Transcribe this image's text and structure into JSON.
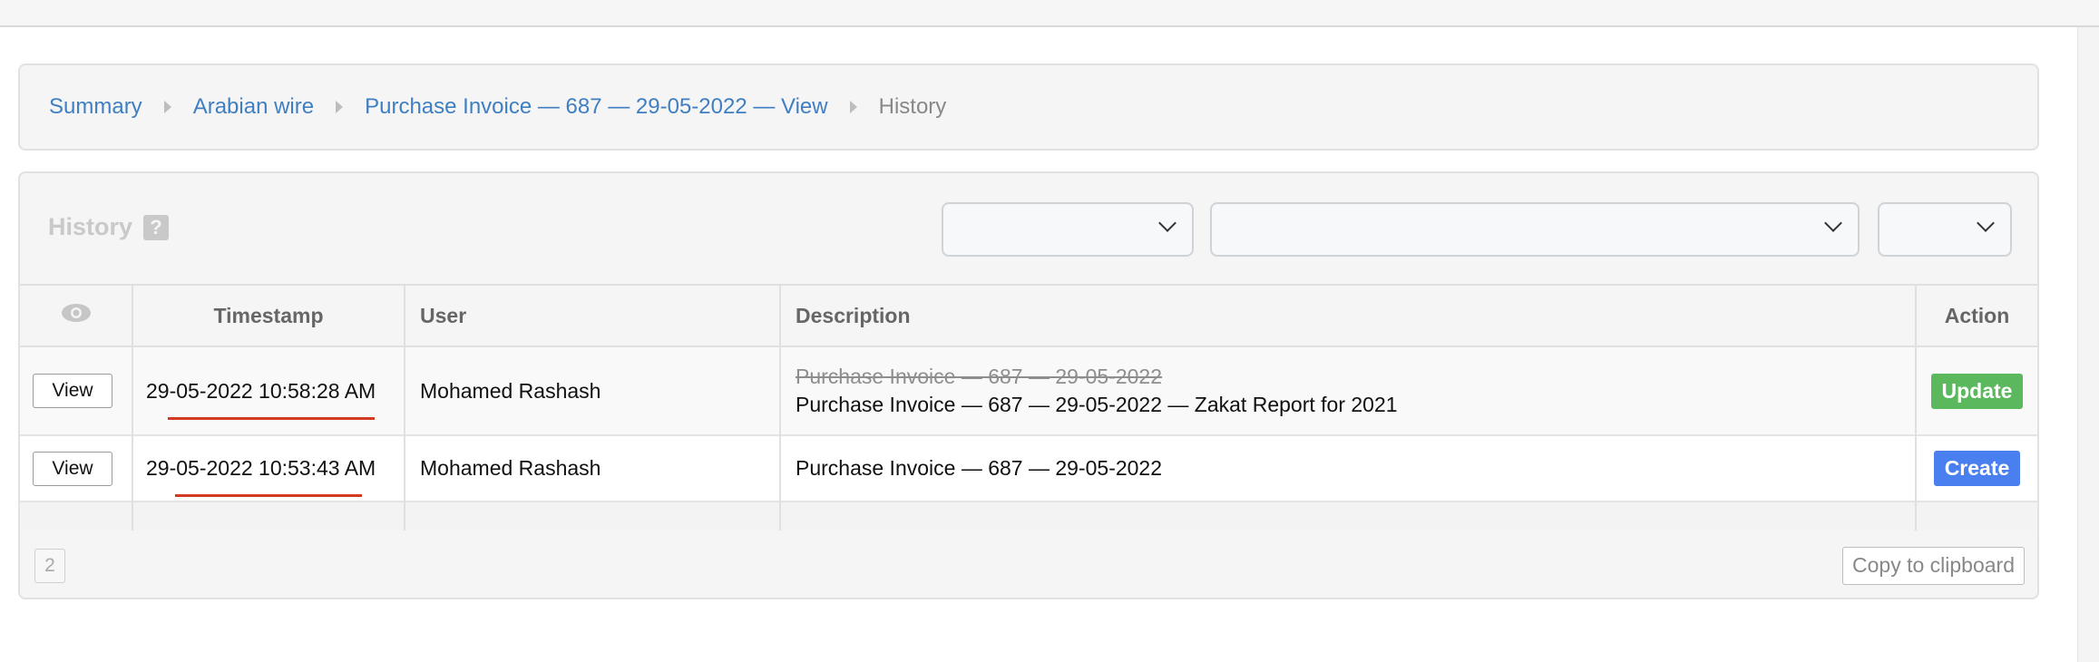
{
  "breadcrumb": {
    "items": [
      {
        "label": "Summary"
      },
      {
        "label": "Arabian wire"
      },
      {
        "label": "Purchase Invoice — 687 — 29-05-2022 — View"
      },
      {
        "label": "History"
      }
    ]
  },
  "history": {
    "title": "History",
    "help_icon": "?",
    "filters": [
      {
        "selected": ""
      },
      {
        "selected": ""
      },
      {
        "selected": ""
      }
    ],
    "columns": [
      "",
      "Timestamp",
      "User",
      "Description",
      "Action"
    ],
    "rows": [
      {
        "view_label": "View",
        "timestamp": "29-05-2022 10:58:28 AM",
        "user": "Mohamed Rashash",
        "old_description": "Purchase Invoice — 687 — 29-05-2022",
        "description": "Purchase Invoice — 687 — 29-05-2022 — Zakat Report for 2021",
        "action": "Update",
        "action_color": "#5cb85c"
      },
      {
        "view_label": "View",
        "timestamp": "29-05-2022 10:53:43 AM",
        "user": "Mohamed Rashash",
        "description": "Purchase Invoice — 687 — 29-05-2022",
        "action": "Create",
        "action_color": "#4a7ff0"
      }
    ],
    "footer": {
      "page": "2",
      "copy_label": "Copy to clipboard"
    }
  },
  "colors": {
    "link": "#3f7fc1",
    "annotation_underline": "#d23b1f"
  }
}
